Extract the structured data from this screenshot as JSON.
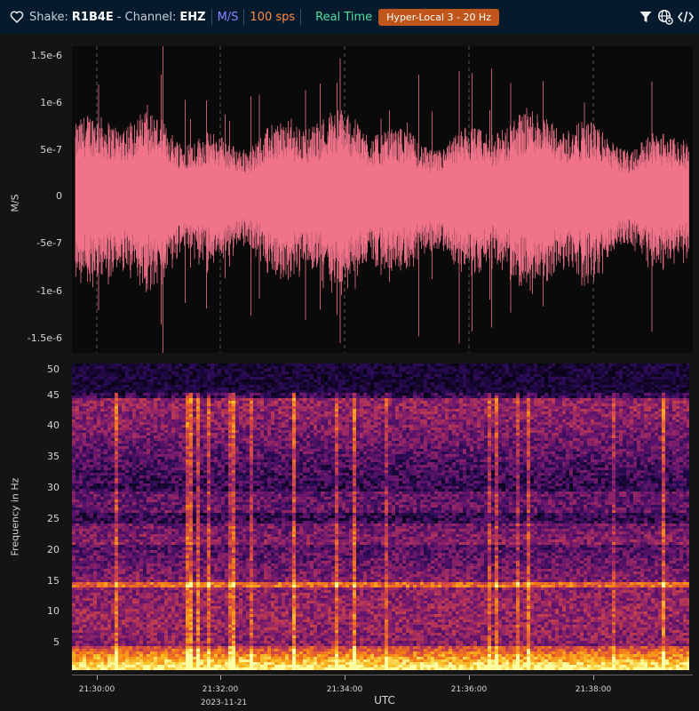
{
  "header": {
    "shake_label": "Shake:",
    "shake_id": "R1B4E",
    "channel_label": "- Channel:",
    "channel_id": "EHZ",
    "units": "M/S",
    "sps": "100 sps",
    "mode": "Real Time",
    "filter": "Hyper-Local 3 - 20 Hz"
  },
  "icons": [
    "heart-icon",
    "filter-icon",
    "globe-gear-icon",
    "code-icon"
  ],
  "colors": {
    "background": "#141414",
    "topbar": "#061a2e",
    "waveform": "#f0738a",
    "units": "#8c83ff",
    "sps": "#ff8a3d",
    "realtime": "#4fe0a0",
    "filter_badge": "#c0561b"
  },
  "chart_data": [
    {
      "type": "line",
      "ylabel": "M/S",
      "yticks": [
        "1.5e-6",
        "1e-6",
        "5e-7",
        "0",
        "-5e-7",
        "-1e-6",
        "-1.5e-6"
      ],
      "ytick_values": [
        1.5e-06,
        1e-06,
        5e-07,
        0,
        -5e-07,
        -1e-06,
        -1.5e-06
      ],
      "ylim": [
        -1.7e-06,
        1.5e-06
      ],
      "grid": "vertical dashed at minute marks"
    },
    {
      "type": "heatmap",
      "ylabel": "Frequency in Hz",
      "yticks": [
        "50",
        "45",
        "40",
        "35",
        "30",
        "25",
        "20",
        "15",
        "10",
        "5"
      ],
      "ytick_values": [
        50,
        45,
        40,
        35,
        30,
        25,
        20,
        15,
        10,
        5
      ],
      "ylim": [
        0,
        50
      ],
      "band_hz": [
        14.5,
        23,
        28
      ],
      "colormap": "inferno"
    }
  ],
  "xaxis": {
    "label": "UTC",
    "ticks": [
      "21:30:00",
      "21:32:00",
      "21:34:00",
      "21:36:00",
      "21:38:00"
    ],
    "date": "2023-11-21"
  }
}
